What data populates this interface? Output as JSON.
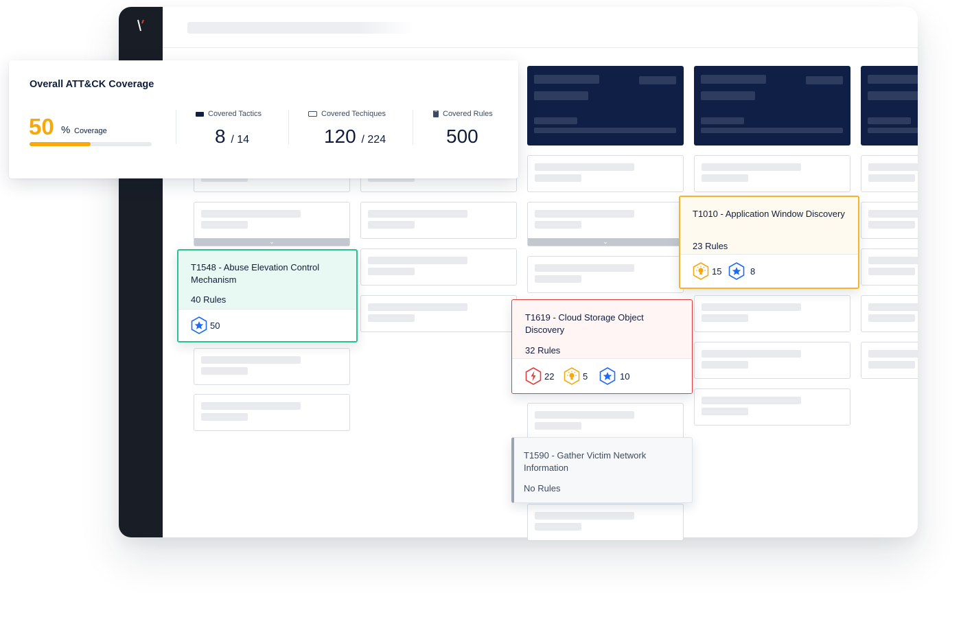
{
  "app": {
    "logo": "brand-logo"
  },
  "coverage_panel": {
    "title": "Overall ATT&CK Coverage",
    "percent": "50",
    "percent_sign": "%",
    "percent_label": "Coverage",
    "progress_fraction": 0.5,
    "tactics": {
      "label": "Covered Tactics",
      "value": "8",
      "total": "/ 14"
    },
    "techniques": {
      "label": "Covered Techiques",
      "value": "120",
      "total": "/ 224"
    },
    "rules": {
      "label": "Covered Rules",
      "value": "500"
    }
  },
  "technique_cards": [
    {
      "title": "T1548 - Abuse Elevation Control Mechanism",
      "rules": "40 Rules",
      "badges": [
        {
          "icon": "star-icon",
          "count": "50",
          "color": "#1e6af0"
        }
      ],
      "accent": "#2bbf93",
      "bg": "#e8f8f3"
    },
    {
      "title": "T1010 - Application Window Discovery",
      "rules": "23 Rules",
      "badges": [
        {
          "icon": "bulb-icon",
          "count": "15",
          "color": "#f6a90f"
        },
        {
          "icon": "star-icon",
          "count": "8",
          "color": "#1e6af0"
        }
      ],
      "accent": "#f6b42a",
      "bg": "#fffaf0"
    },
    {
      "title": "T1619 - Cloud Storage Object Discovery",
      "rules": "32 Rules",
      "badges": [
        {
          "icon": "bolt-icon",
          "count": "22",
          "color": "#e23b3b"
        },
        {
          "icon": "bulb-icon",
          "count": "5",
          "color": "#f6a90f"
        },
        {
          "icon": "star-icon",
          "count": "10",
          "color": "#1e6af0"
        }
      ],
      "accent": "#e23b3b",
      "bg": "#fff5f5"
    },
    {
      "title": "T1590 - Gather Victim Network Information",
      "rules": "No Rules",
      "badges": [],
      "accent": "#9aa3b2",
      "bg": "#f7f8f9"
    }
  ],
  "colors": {
    "brand_dark": "#0f1f45",
    "sidebar": "#181d26",
    "accent_logo": "#e23b3b"
  }
}
